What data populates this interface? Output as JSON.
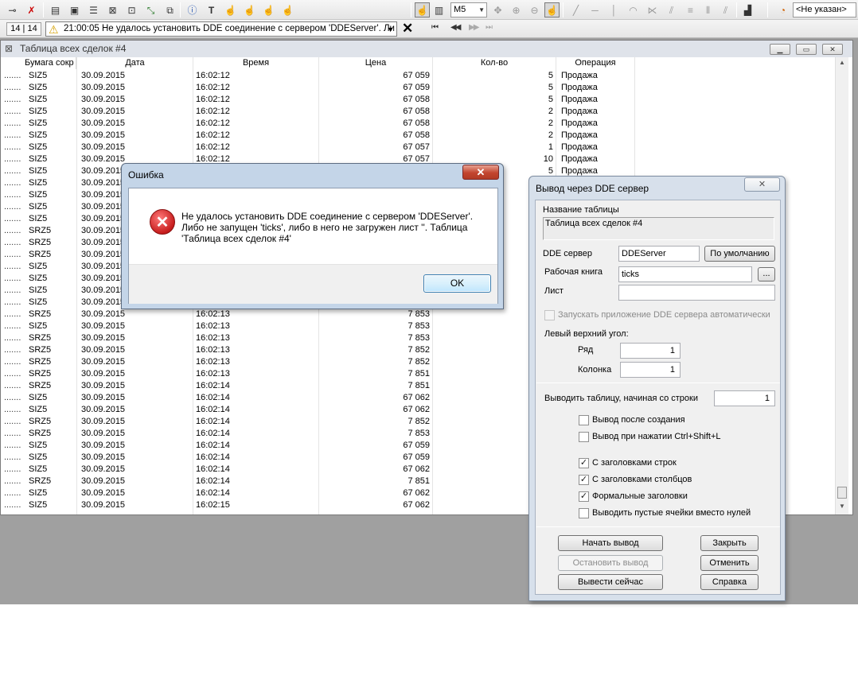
{
  "toolbar2": {
    "counter": "14 | 14",
    "message": "21:00:05  Не удалось установить DDE соединение с сервером 'DDEServer'. Ли",
    "interval": "M5",
    "class_code": "<Не указан>"
  },
  "table_window": {
    "title": "Таблица всех сделок #4",
    "columns": [
      "Бумага сокр",
      "Дата",
      "Время",
      "Цена",
      "Кол-во",
      "Операция"
    ],
    "rows": [
      {
        "sec": "SIZ5",
        "date": "30.09.2015",
        "time": "16:02:12",
        "price": "67 059",
        "qty": "5",
        "op": "Продажа"
      },
      {
        "sec": "SIZ5",
        "date": "30.09.2015",
        "time": "16:02:12",
        "price": "67 059",
        "qty": "5",
        "op": "Продажа"
      },
      {
        "sec": "SIZ5",
        "date": "30.09.2015",
        "time": "16:02:12",
        "price": "67 058",
        "qty": "5",
        "op": "Продажа"
      },
      {
        "sec": "SIZ5",
        "date": "30.09.2015",
        "time": "16:02:12",
        "price": "67 058",
        "qty": "2",
        "op": "Продажа"
      },
      {
        "sec": "SIZ5",
        "date": "30.09.2015",
        "time": "16:02:12",
        "price": "67 058",
        "qty": "2",
        "op": "Продажа"
      },
      {
        "sec": "SIZ5",
        "date": "30.09.2015",
        "time": "16:02:12",
        "price": "67 058",
        "qty": "2",
        "op": "Продажа"
      },
      {
        "sec": "SIZ5",
        "date": "30.09.2015",
        "time": "16:02:12",
        "price": "67 057",
        "qty": "1",
        "op": "Продажа"
      },
      {
        "sec": "SIZ5",
        "date": "30.09.2015",
        "time": "16:02:12",
        "price": "67 057",
        "qty": "10",
        "op": "Продажа"
      },
      {
        "sec": "SIZ5",
        "date": "30.09.2015",
        "time": "",
        "price": "",
        "qty": "5",
        "op": "Продажа"
      },
      {
        "sec": "SIZ5",
        "date": "30.09.2015",
        "time": "",
        "price": "",
        "qty": "",
        "op": ""
      },
      {
        "sec": "SIZ5",
        "date": "30.09.2015",
        "time": "",
        "price": "",
        "qty": "",
        "op": ""
      },
      {
        "sec": "SIZ5",
        "date": "30.09.2015",
        "time": "",
        "price": "",
        "qty": "",
        "op": ""
      },
      {
        "sec": "SIZ5",
        "date": "30.09.2015",
        "time": "",
        "price": "",
        "qty": "",
        "op": ""
      },
      {
        "sec": "SRZ5",
        "date": "30.09.2015",
        "time": "",
        "price": "",
        "qty": "",
        "op": ""
      },
      {
        "sec": "SRZ5",
        "date": "30.09.2015",
        "time": "",
        "price": "",
        "qty": "",
        "op": ""
      },
      {
        "sec": "SRZ5",
        "date": "30.09.2015",
        "time": "",
        "price": "",
        "qty": "",
        "op": ""
      },
      {
        "sec": "SIZ5",
        "date": "30.09.2015",
        "time": "",
        "price": "",
        "qty": "",
        "op": ""
      },
      {
        "sec": "SIZ5",
        "date": "30.09.2015",
        "time": "",
        "price": "",
        "qty": "",
        "op": ""
      },
      {
        "sec": "SIZ5",
        "date": "30.09.2015",
        "time": "",
        "price": "",
        "qty": "",
        "op": ""
      },
      {
        "sec": "SIZ5",
        "date": "30.09.2015",
        "time": "",
        "price": "",
        "qty": "",
        "op": ""
      },
      {
        "sec": "SRZ5",
        "date": "30.09.2015",
        "time": "16:02:13",
        "price": "7 853",
        "qty": "",
        "op": ""
      },
      {
        "sec": "SIZ5",
        "date": "30.09.2015",
        "time": "16:02:13",
        "price": "7 853",
        "qty": "",
        "op": ""
      },
      {
        "sec": "SRZ5",
        "date": "30.09.2015",
        "time": "16:02:13",
        "price": "7 853",
        "qty": "",
        "op": ""
      },
      {
        "sec": "SRZ5",
        "date": "30.09.2015",
        "time": "16:02:13",
        "price": "7 852",
        "qty": "",
        "op": ""
      },
      {
        "sec": "SRZ5",
        "date": "30.09.2015",
        "time": "16:02:13",
        "price": "7 852",
        "qty": "",
        "op": ""
      },
      {
        "sec": "SRZ5",
        "date": "30.09.2015",
        "time": "16:02:13",
        "price": "7 851",
        "qty": "",
        "op": ""
      },
      {
        "sec": "SRZ5",
        "date": "30.09.2015",
        "time": "16:02:14",
        "price": "7 851",
        "qty": "",
        "op": ""
      },
      {
        "sec": "SIZ5",
        "date": "30.09.2015",
        "time": "16:02:14",
        "price": "67 062",
        "qty": "",
        "op": ""
      },
      {
        "sec": "SIZ5",
        "date": "30.09.2015",
        "time": "16:02:14",
        "price": "67 062",
        "qty": "",
        "op": ""
      },
      {
        "sec": "SRZ5",
        "date": "30.09.2015",
        "time": "16:02:14",
        "price": "7 852",
        "qty": "",
        "op": ""
      },
      {
        "sec": "SRZ5",
        "date": "30.09.2015",
        "time": "16:02:14",
        "price": "7 853",
        "qty": "",
        "op": ""
      },
      {
        "sec": "SIZ5",
        "date": "30.09.2015",
        "time": "16:02:14",
        "price": "67 059",
        "qty": "",
        "op": ""
      },
      {
        "sec": "SIZ5",
        "date": "30.09.2015",
        "time": "16:02:14",
        "price": "67 059",
        "qty": "",
        "op": ""
      },
      {
        "sec": "SIZ5",
        "date": "30.09.2015",
        "time": "16:02:14",
        "price": "67 062",
        "qty": "",
        "op": ""
      },
      {
        "sec": "SRZ5",
        "date": "30.09.2015",
        "time": "16:02:14",
        "price": "7 851",
        "qty": "",
        "op": ""
      },
      {
        "sec": "SIZ5",
        "date": "30.09.2015",
        "time": "16:02:14",
        "price": "67 062",
        "qty": "",
        "op": ""
      },
      {
        "sec": "SIZ5",
        "date": "30.09.2015",
        "time": "16:02:15",
        "price": "67 062",
        "qty": "",
        "op": ""
      }
    ]
  },
  "error_dialog": {
    "title": "Ошибка",
    "close_glyph": "✕",
    "line1": "Не удалось установить DDE соединение с сервером 'DDEServer'.",
    "line2": "Либо не запущен 'ticks', либо в него не загружен лист ''. Таблица",
    "line3": "'Таблица всех сделок #4'",
    "ok_label": "OK"
  },
  "dde_dialog": {
    "title": "Вывод через DDE сервер",
    "close_glyph": "✕",
    "table_name_label": "Название таблицы",
    "table_name_value": "Таблица всех сделок #4",
    "server_label": "DDE сервер",
    "server_value": "DDEServer",
    "default_button": "По умолчанию",
    "workbook_label": "Рабочая книга",
    "workbook_value": "ticks",
    "browse_button": "...",
    "sheet_label": "Лист",
    "sheet_value": "",
    "autostart_label": "Запускать приложение DDE сервера автоматически",
    "corner_label": "Левый верхний угол:",
    "row_label": "Ряд",
    "row_value": "1",
    "col_label": "Колонка",
    "col_value": "1",
    "start_row_label": "Выводить таблицу,  начиная со строки",
    "start_row_value": "1",
    "opt_after_create": "Вывод после создания",
    "opt_hotkey": "Вывод при нажатии Ctrl+Shift+L",
    "opt_row_headers": "С заголовками строк",
    "opt_col_headers": "С заголовками столбцов",
    "opt_formal_headers": "Формальные заголовки",
    "opt_empty_cells": "Выводить пустые ячейки вместо нулей",
    "btn_start": "Начать вывод",
    "btn_stop": "Остановить вывод",
    "btn_now": "Вывести сейчас",
    "btn_close": "Закрыть",
    "btn_cancel": "Отменить",
    "btn_help": "Справка",
    "checks": {
      "autostart": false,
      "after_create": false,
      "hotkey": false,
      "row_headers": true,
      "col_headers": true,
      "formal_headers": true,
      "empty_cells": false
    }
  }
}
